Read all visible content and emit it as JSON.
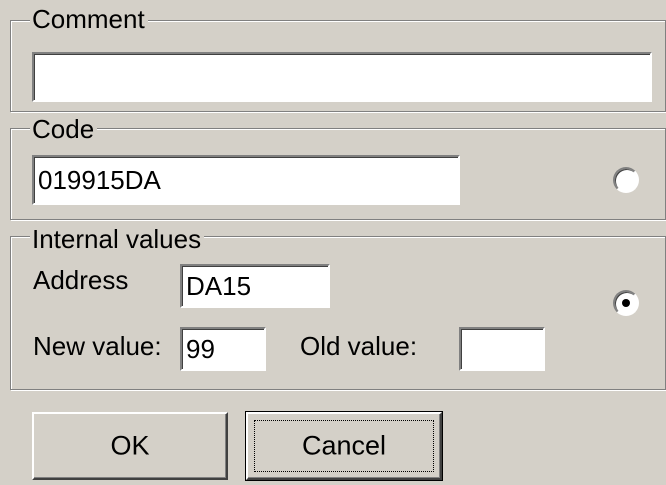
{
  "comment_group": {
    "legend": "Comment",
    "value": ""
  },
  "code_group": {
    "legend": "Code",
    "value": "019915DA",
    "radio_selected": false
  },
  "internal_group": {
    "legend": "Internal values",
    "address_label": "Address",
    "address_value": "DA15",
    "new_value_label": "New value:",
    "new_value": "99",
    "old_value_label": "Old value:",
    "old_value": "",
    "radio_selected": true
  },
  "buttons": {
    "ok": "OK",
    "cancel": "Cancel"
  }
}
